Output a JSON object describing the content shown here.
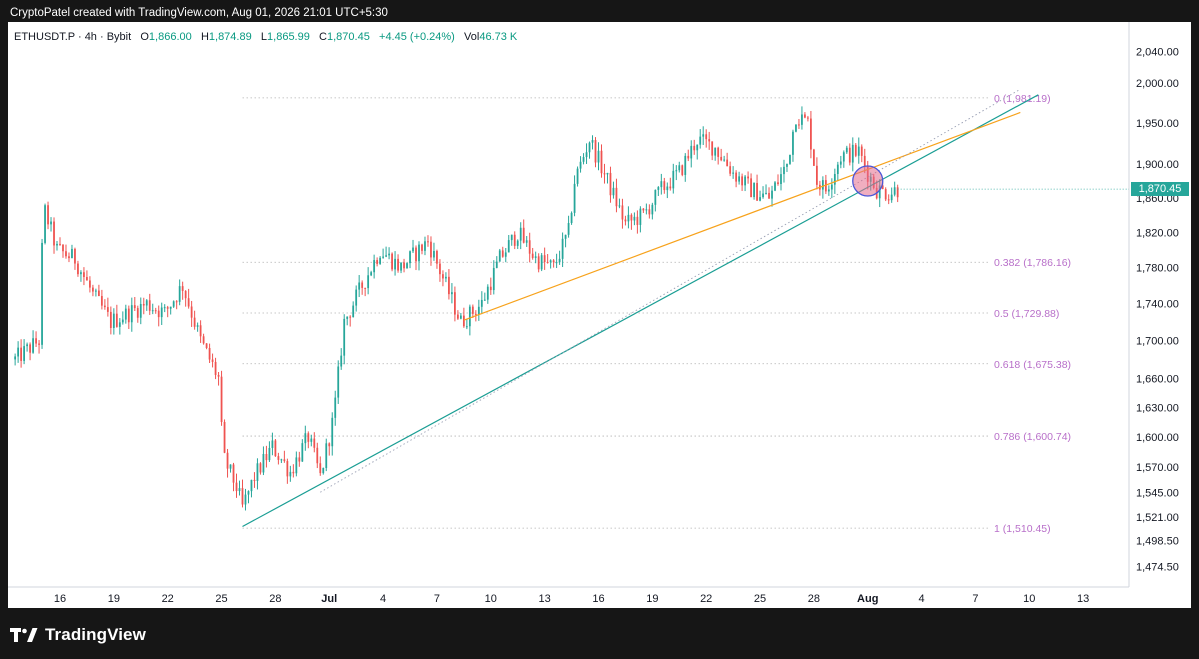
{
  "header": {
    "credit": "CryptoPatel created with TradingView.com, Aug 01, 2026 21:01 UTC+5:30"
  },
  "legend": {
    "symbol": "ETHUSDT.P · 4h · Bybit",
    "open_label": "O",
    "open": "1,866.00",
    "high_label": "H",
    "high": "1,874.89",
    "low_label": "L",
    "low": "1,865.99",
    "close_label": "C",
    "close": "1,870.45",
    "change": "+4.45 (+0.24%)",
    "volume_label": "Vol",
    "volume": "46.73 K"
  },
  "current_price_label": "1,870.45",
  "footer": {
    "brand": "TradingView"
  },
  "colors": {
    "up": "#26a69a",
    "down": "#ef5350",
    "fib": "#b86fc9",
    "trend_teal": "#1a9e94",
    "trend_orange": "#f7a21b",
    "marker": "#e36b8d"
  },
  "chart_data": {
    "type": "candlestick",
    "title": "",
    "xlabel": "",
    "ylabel": "",
    "y_scale": "log",
    "ylim": [
      1460,
      2060
    ],
    "x_ticks": [
      "16",
      "19",
      "22",
      "25",
      "28",
      "Jul",
      "4",
      "7",
      "10",
      "13",
      "16",
      "19",
      "22",
      "25",
      "28",
      "Aug",
      "4",
      "7",
      "10",
      "13"
    ],
    "y_ticks": [
      "2,040.00",
      "2,000.00",
      "1,950.00",
      "1,900.00",
      "1,860.00",
      "1,820.00",
      "1,780.00",
      "1,740.00",
      "1,700.00",
      "1,660.00",
      "1,630.00",
      "1,600.00",
      "1,570.00",
      "1,545.00",
      "1,521.00",
      "1,498.50",
      "1,474.50"
    ],
    "fib_levels": [
      {
        "label": "0 (1,981.19)",
        "value": 1981.19
      },
      {
        "label": "0.382 (1,786.16)",
        "value": 1786.16
      },
      {
        "label": "0.5 (1,729.88)",
        "value": 1729.88
      },
      {
        "label": "0.618 (1,675.38)",
        "value": 1675.38
      },
      {
        "label": "0.786 (1,600.74)",
        "value": 1600.74
      },
      {
        "label": "1 (1,510.45)",
        "value": 1510.45
      }
    ],
    "price_path": [
      [
        "Jun 13 12:00",
        1680
      ],
      [
        "Jun 14 20:00",
        1700
      ],
      [
        "Jun 15 02:00",
        1850
      ],
      [
        "Jun 15 20:00",
        1800
      ],
      [
        "Jun 16 20:00",
        1790
      ],
      [
        "Jun 17 20:00",
        1750
      ],
      [
        "Jun 18 20:00",
        1720
      ],
      [
        "Jun 19 20:00",
        1730
      ],
      [
        "Jun 20 20:00",
        1740
      ],
      [
        "Jun 21 20:00",
        1730
      ],
      [
        "Jun 22 20:00",
        1760
      ],
      [
        "Jun 23 20:00",
        1700
      ],
      [
        "Jun 24 20:00",
        1660
      ],
      [
        "Jun 25 02:00",
        1580
      ],
      [
        "Jun 25 20:00",
        1550
      ],
      [
        "Jun 26 04:00",
        1530
      ],
      [
        "Jun 26 20:00",
        1560
      ],
      [
        "Jun 27 20:00",
        1590
      ],
      [
        "Jun 28 20:00",
        1565
      ],
      [
        "Jun 29 20:00",
        1600
      ],
      [
        "Jun 30 12:00",
        1560
      ],
      [
        "Jul 1 06:00",
        1620
      ],
      [
        "Jul 1 20:00",
        1720
      ],
      [
        "Jul 2 20:00",
        1760
      ],
      [
        "Jul 3 20:00",
        1800
      ],
      [
        "Jul 5 00:00",
        1780
      ],
      [
        "Jul 6 12:00",
        1810
      ],
      [
        "Jul 7 12:00",
        1760
      ],
      [
        "Jul 8 08:00",
        1720
      ],
      [
        "Jul 9 12:00",
        1740
      ],
      [
        "Jul 10 12:00",
        1790
      ],
      [
        "Jul 11 12:00",
        1820
      ],
      [
        "Jul 12 12:00",
        1790
      ],
      [
        "Jul 13 12:00",
        1780
      ],
      [
        "Jul 14 08:00",
        1820
      ],
      [
        "Jul 14 16:00",
        1880
      ],
      [
        "Jul 15 12:00",
        1930
      ],
      [
        "Jul 16 12:00",
        1880
      ],
      [
        "Jul 17 12:00",
        1830
      ],
      [
        "Jul 18 12:00",
        1840
      ],
      [
        "Jul 19 12:00",
        1870
      ],
      [
        "Jul 20 12:00",
        1890
      ],
      [
        "Jul 21 12:00",
        1930
      ],
      [
        "Jul 22 12:00",
        1920
      ],
      [
        "Jul 23 12:00",
        1890
      ],
      [
        "Jul 24 12:00",
        1870
      ],
      [
        "Jul 25 12:00",
        1860
      ],
      [
        "Jul 26 12:00",
        1900
      ],
      [
        "Jul 27 00:00",
        1960
      ],
      [
        "Jul 27 16:00",
        1950
      ],
      [
        "Jul 28 04:00",
        1880
      ],
      [
        "Jul 28 16:00",
        1870
      ],
      [
        "Jul 29 12:00",
        1910
      ],
      [
        "Jul 30 12:00",
        1915
      ],
      [
        "Jul 31 00:00",
        1890
      ],
      [
        "Jul 31 12:00",
        1870
      ],
      [
        "Aug 1 04:00",
        1866
      ],
      [
        "Aug 1 16:00",
        1870.45
      ]
    ],
    "trendlines": [
      {
        "name": "teal",
        "from": [
          "Jun 26 04:00",
          1512
        ],
        "to": [
          "Aug 9 12:00",
          1985
        ]
      },
      {
        "name": "orange",
        "from": [
          "Jul 8 12:00",
          1722
        ],
        "to": [
          "Aug 8 12:00",
          1963
        ]
      },
      {
        "name": "dotted",
        "from": [
          "Jun 30 12:00",
          1545
        ],
        "to": [
          "Aug 8 12:00",
          1992
        ]
      }
    ],
    "marker": {
      "at": [
        "Jul 31 00:00",
        1880
      ]
    }
  }
}
